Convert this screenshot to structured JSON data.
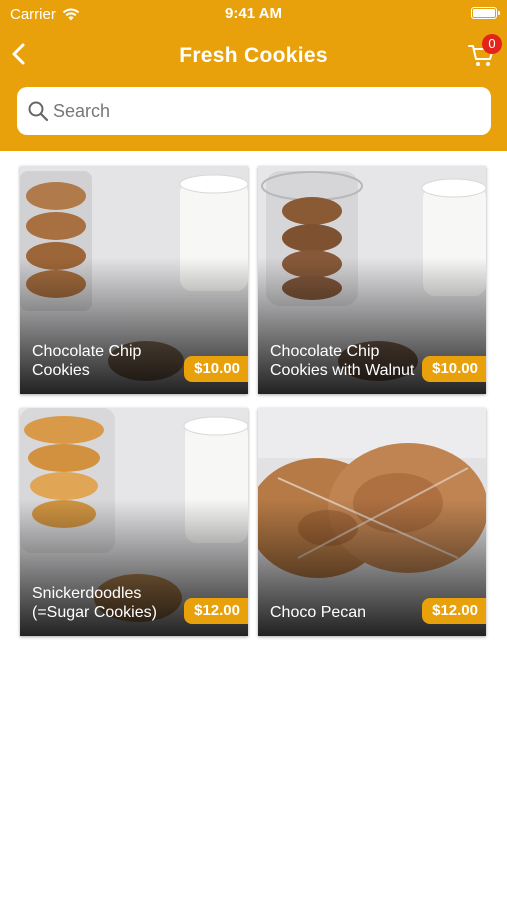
{
  "status_bar": {
    "carrier": "Carrier",
    "time": "9:41 AM"
  },
  "nav": {
    "title": "Fresh Cookies",
    "cart_count": "0"
  },
  "search": {
    "placeholder": "Search",
    "value": ""
  },
  "colors": {
    "accent": "#e8a10a",
    "badge": "#e3241b",
    "price_bg": "#e8a10a"
  },
  "products": [
    {
      "name": "Chocolate Chip Cookies",
      "price": "$10.00"
    },
    {
      "name": "Chocolate Chip Cookies with Walnut",
      "price": "$10.00"
    },
    {
      "name": "Snickerdoodles (=Sugar Cookies)",
      "price": "$12.00"
    },
    {
      "name": "Choco Pecan",
      "price": "$12.00"
    }
  ]
}
